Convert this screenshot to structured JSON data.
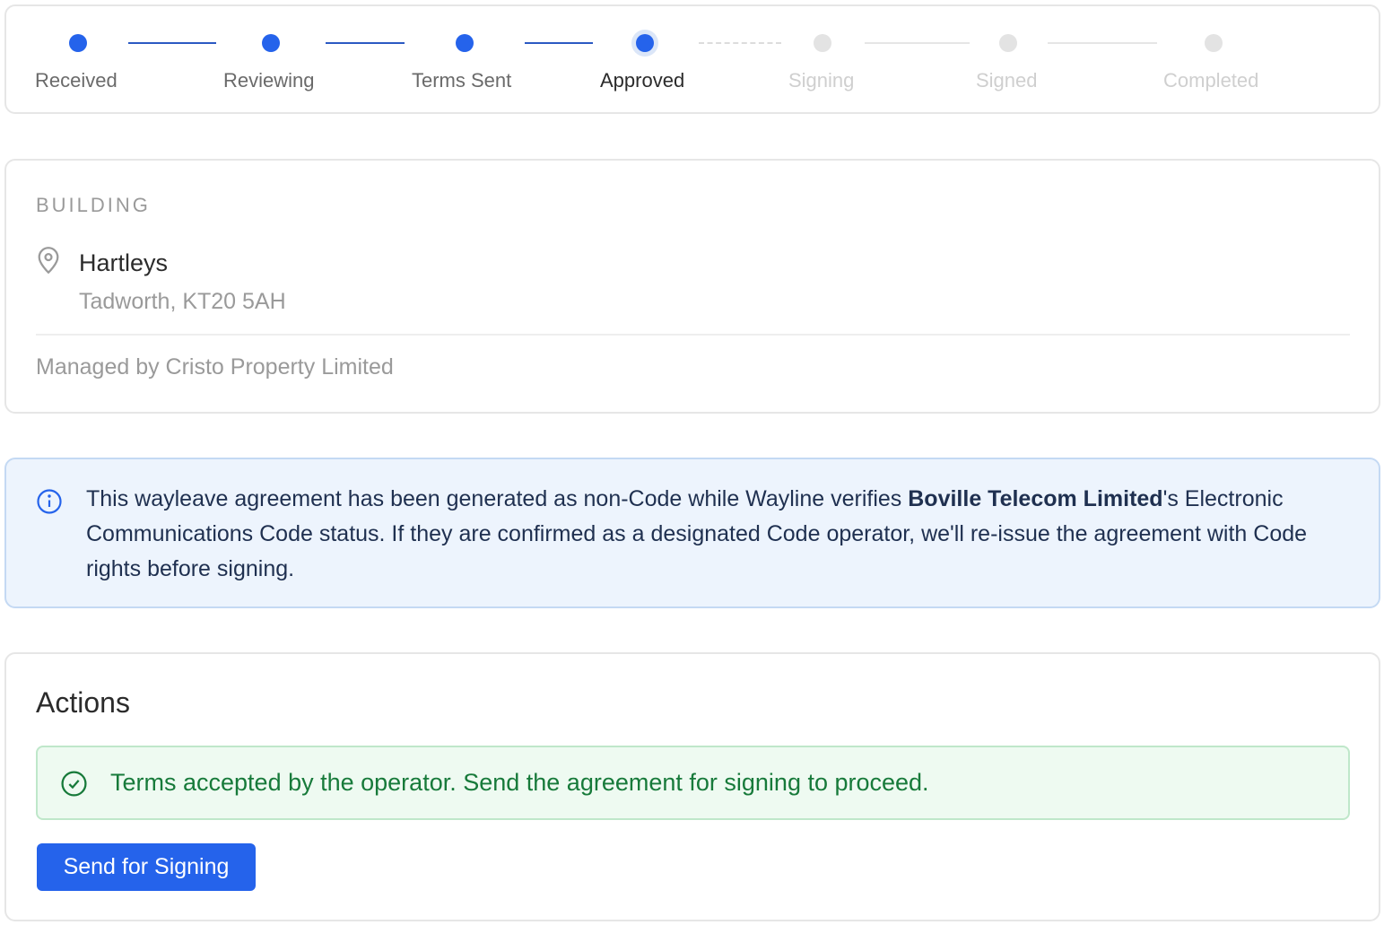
{
  "stepper": {
    "steps": [
      {
        "label": "Received",
        "state": "done"
      },
      {
        "label": "Reviewing",
        "state": "done"
      },
      {
        "label": "Terms Sent",
        "state": "done"
      },
      {
        "label": "Approved",
        "state": "current"
      },
      {
        "label": "Signing",
        "state": "pending"
      },
      {
        "label": "Signed",
        "state": "pending"
      },
      {
        "label": "Completed",
        "state": "pending"
      }
    ]
  },
  "building": {
    "section_label": "BUILDING",
    "name": "Hartleys",
    "address": "Tadworth, KT20 5AH",
    "managed_by": "Managed by Cristo Property Limited",
    "icon": "map-pin-icon"
  },
  "info_notice": {
    "icon": "info-icon",
    "text_before": "This wayleave agreement has been generated as non-Code while Wayline verifies ",
    "operator": "Boville Telecom Limited",
    "text_after": "'s Electronic Communications Code status. If they are confirmed as a designated Code operator, we'll re-issue the agreement with Code rights before signing."
  },
  "actions": {
    "title": "Actions",
    "success_message": "Terms accepted by the operator. Send the agreement for signing to proceed.",
    "success_icon": "check-circle-icon",
    "primary_button": "Send for Signing"
  },
  "colors": {
    "accent": "#2563eb",
    "pending": "#e3e3e3",
    "info_bg": "#edf4fd",
    "success_bg": "#eefaf1",
    "success_text": "#177a3a"
  }
}
